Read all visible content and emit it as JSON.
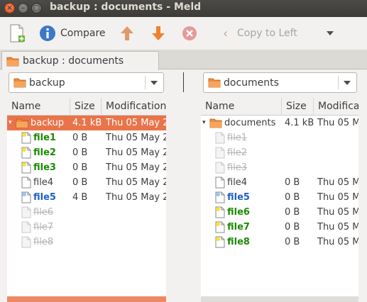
{
  "window": {
    "title": "backup : documents - Meld"
  },
  "toolbar": {
    "compare_label": "Compare",
    "copy_to_left_label": "Copy to Left"
  },
  "tab": {
    "label": "backup : documents"
  },
  "left_combo": {
    "value": "backup"
  },
  "right_combo": {
    "value": "documents"
  },
  "left_pane": {
    "headers": {
      "name": "Name",
      "size": "Size",
      "modification": "Modification"
    },
    "rows": [
      {
        "name": "backup",
        "size": "4.1 kB",
        "date": "Thu 05 May 2",
        "state": "folder",
        "selected": true
      },
      {
        "name": "file1",
        "size": "0 B",
        "date": "Thu 05 May 2",
        "state": "new"
      },
      {
        "name": "file2",
        "size": "0 B",
        "date": "Thu 05 May 2",
        "state": "new"
      },
      {
        "name": "file3",
        "size": "0 B",
        "date": "Thu 05 May 2",
        "state": "new"
      },
      {
        "name": "file4",
        "size": "0 B",
        "date": "Thu 05 May 2",
        "state": "normal"
      },
      {
        "name": "file5",
        "size": "4 B",
        "date": "Thu 05 May 2",
        "state": "modified"
      },
      {
        "name": "file6",
        "size": "",
        "date": "",
        "state": "missing"
      },
      {
        "name": "file7",
        "size": "",
        "date": "",
        "state": "missing"
      },
      {
        "name": "file8",
        "size": "",
        "date": "",
        "state": "missing"
      }
    ]
  },
  "right_pane": {
    "headers": {
      "name": "Name",
      "size": "Size",
      "modification": "Modifica"
    },
    "rows": [
      {
        "name": "documents",
        "size": "4.1 kB",
        "date": "Thu 05 M",
        "state": "folder"
      },
      {
        "name": "file1",
        "size": "",
        "date": "",
        "state": "missing"
      },
      {
        "name": "file2",
        "size": "",
        "date": "",
        "state": "missing"
      },
      {
        "name": "file3",
        "size": "",
        "date": "",
        "state": "missing"
      },
      {
        "name": "file4",
        "size": "0 B",
        "date": "Thu 05 M",
        "state": "normal"
      },
      {
        "name": "file5",
        "size": "0 B",
        "date": "Thu 05 M",
        "state": "modified"
      },
      {
        "name": "file6",
        "size": "0 B",
        "date": "Thu 05 M",
        "state": "new"
      },
      {
        "name": "file7",
        "size": "0 B",
        "date": "Thu 05 M",
        "state": "new"
      },
      {
        "name": "file8",
        "size": "0 B",
        "date": "Thu 05 M",
        "state": "new"
      }
    ]
  },
  "colors": {
    "accent": "#e9744a",
    "new": "#1b8a00",
    "modified": "#1f5ec7",
    "missing": "#b5b5b5"
  }
}
